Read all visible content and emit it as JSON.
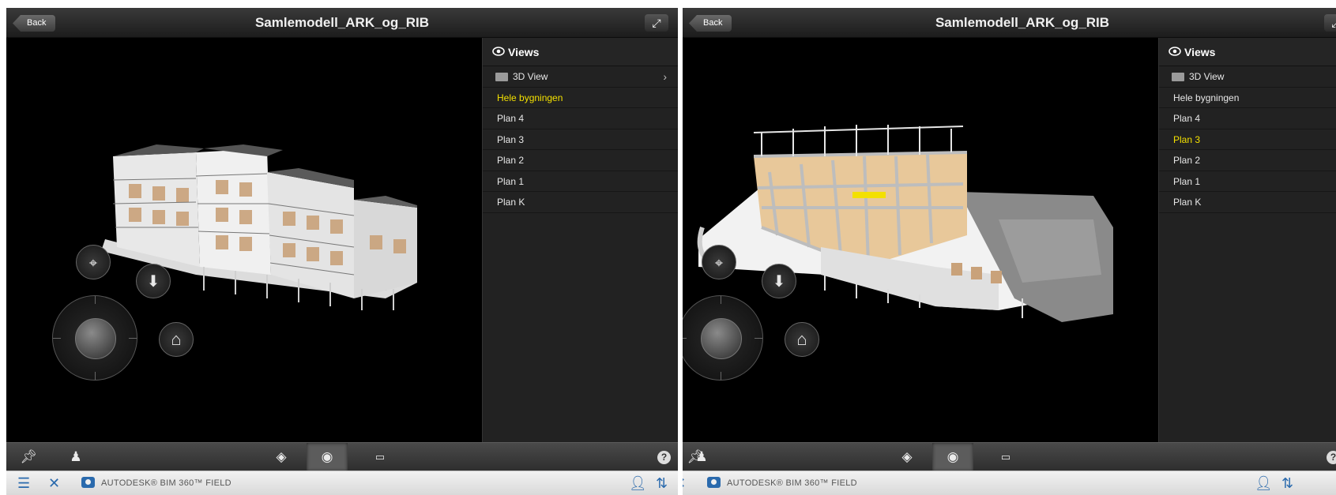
{
  "left": {
    "back_label": "Back",
    "title": "Samlemodell_ARK_og_RIB",
    "views_title": "Views",
    "folder_label": "3D View",
    "views": [
      {
        "label": "Hele bygningen",
        "active": true
      },
      {
        "label": "Plan 4",
        "active": false
      },
      {
        "label": "Plan 3",
        "active": false
      },
      {
        "label": "Plan 2",
        "active": false
      },
      {
        "label": "Plan 1",
        "active": false
      },
      {
        "label": "Plan K",
        "active": false
      }
    ],
    "brand": "AUTODESK® BIM 360™ FIELD",
    "help": "?"
  },
  "right": {
    "back_label": "Back",
    "title": "Samlemodell_ARK_og_RIB",
    "views_title": "Views",
    "folder_label": "3D View",
    "views": [
      {
        "label": "Hele bygningen",
        "active": false
      },
      {
        "label": "Plan 4",
        "active": false
      },
      {
        "label": "Plan 3",
        "active": true
      },
      {
        "label": "Plan 2",
        "active": false
      },
      {
        "label": "Plan 1",
        "active": false
      },
      {
        "label": "Plan K",
        "active": false
      }
    ],
    "brand": "AUTODESK® BIM 360™ FIELD",
    "help": "?"
  },
  "colors": {
    "active_view": "#f3e000",
    "accent": "#2a6aad"
  },
  "icons": [
    "pin-icon",
    "stamp-icon",
    "objects-icon",
    "views-eye-icon",
    "measure-icon",
    "help-icon",
    "menu-icon",
    "tools-icon",
    "camera-icon",
    "user-icon",
    "sync-icon",
    "expand-icon",
    "orbit-icon",
    "fly-down-icon",
    "home-icon"
  ]
}
